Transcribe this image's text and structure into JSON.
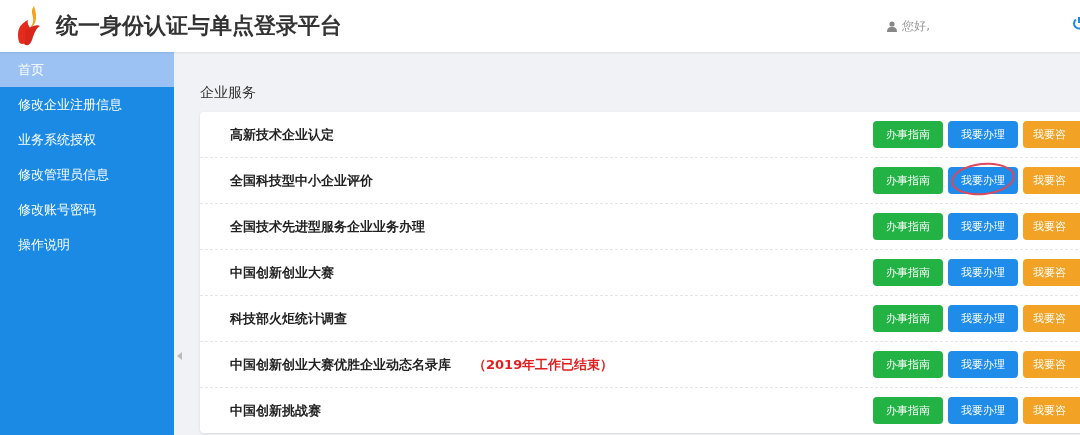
{
  "header": {
    "title": "统一身份认证与单点登录平台",
    "greeting": "您好,"
  },
  "sidebar": {
    "items": [
      {
        "label": "首页",
        "selected": true
      },
      {
        "label": "修改企业注册信息",
        "selected": false
      },
      {
        "label": "业务系统授权",
        "selected": false
      },
      {
        "label": "修改管理员信息",
        "selected": false
      },
      {
        "label": "修改账号密码",
        "selected": false
      },
      {
        "label": "操作说明",
        "selected": false
      }
    ]
  },
  "section": {
    "title": "企业服务",
    "rows": [
      {
        "name": "高新技术企业认定",
        "buttons": [
          {
            "kind": "guide",
            "label": "办事指南",
            "circled": false
          },
          {
            "kind": "apply",
            "label": "我要办理",
            "circled": false
          },
          {
            "kind": "consult",
            "label": "我要咨",
            "circled": false
          }
        ]
      },
      {
        "name": "全国科技型中小企业评价",
        "buttons": [
          {
            "kind": "guide",
            "label": "办事指南",
            "circled": false
          },
          {
            "kind": "apply",
            "label": "我要办理",
            "circled": true
          },
          {
            "kind": "consult",
            "label": "我要咨",
            "circled": false
          }
        ]
      },
      {
        "name": "全国技术先进型服务企业业务办理",
        "buttons": [
          {
            "kind": "guide",
            "label": "办事指南",
            "circled": false
          },
          {
            "kind": "apply",
            "label": "我要办理",
            "circled": false
          },
          {
            "kind": "consult",
            "label": "我要咨",
            "circled": false
          }
        ]
      },
      {
        "name": "中国创新创业大赛",
        "buttons": [
          {
            "kind": "guide",
            "label": "办事指南",
            "circled": false
          },
          {
            "kind": "apply",
            "label": "我要办理",
            "circled": false
          },
          {
            "kind": "consult",
            "label": "我要咨",
            "circled": false
          }
        ]
      },
      {
        "name": "科技部火炬统计调查",
        "buttons": [
          {
            "kind": "guide",
            "label": "办事指南",
            "circled": false
          },
          {
            "kind": "apply",
            "label": "我要办理",
            "circled": false
          },
          {
            "kind": "consult",
            "label": "我要咨",
            "circled": false
          }
        ]
      },
      {
        "name": "中国创新创业大赛优胜企业动态名录库",
        "note": "（2019年工作已结束）",
        "buttons": [
          {
            "kind": "guide",
            "label": "办事指南",
            "circled": false
          },
          {
            "kind": "apply",
            "label": "我要办理",
            "circled": false
          },
          {
            "kind": "consult",
            "label": "我要咨",
            "circled": false
          }
        ]
      },
      {
        "name": "中国创新挑战赛",
        "buttons": [
          {
            "kind": "guide",
            "label": "办事指南",
            "circled": false
          },
          {
            "kind": "apply",
            "label": "我要办理",
            "circled": false
          },
          {
            "kind": "consult",
            "label": "我要咨",
            "circled": false
          }
        ]
      }
    ]
  }
}
